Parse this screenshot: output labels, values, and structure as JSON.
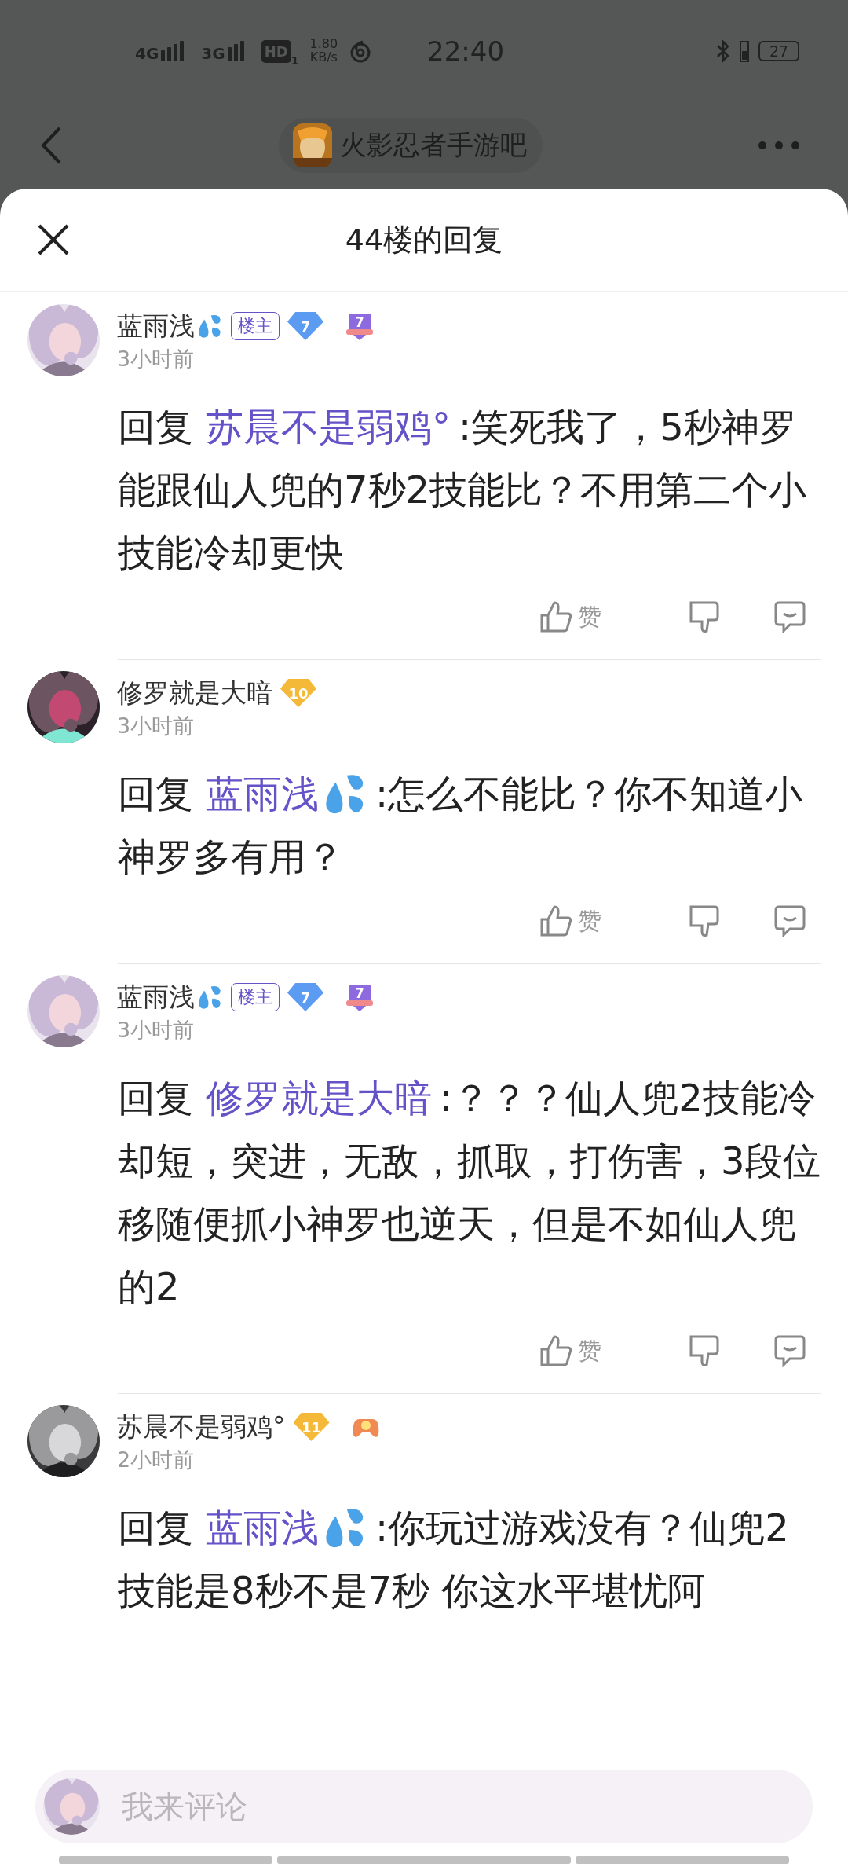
{
  "status_bar": {
    "network_1": "4G",
    "network_2": "3G",
    "hd": "HD",
    "hd_sub": "1",
    "speed_value": "1.80",
    "speed_unit": "KB/s",
    "time": "22:40",
    "battery": "27"
  },
  "nav": {
    "forum_name": "火影忍者手游吧"
  },
  "sheet": {
    "title": "44楼的回复"
  },
  "comments": [
    {
      "user": "蓝雨浅",
      "name_emoji": {
        "kind": "droplets"
      },
      "host_tag": "楼主",
      "level": {
        "label": "7",
        "color": "#5b9cf2"
      },
      "medal": {
        "kind": "shield",
        "label": "7"
      },
      "time": "3小时前",
      "reply_prefix": "回复",
      "reply_to": "苏晨不是弱鸡°",
      "text": ":笑死我了，5秒神罗能跟仙人兜的7秒2技能比？不用第二个小技能冷却更快",
      "like_label": "赞"
    },
    {
      "user": "修罗就是大暗",
      "level": {
        "label": "10",
        "color": "#f5b93a"
      },
      "time": "3小时前",
      "reply_prefix": "回复",
      "reply_to": "蓝雨浅",
      "reply_to_emoji": {
        "kind": "droplets"
      },
      "text": ":怎么不能比？你不知道小神罗多有用？",
      "like_label": "赞"
    },
    {
      "user": "蓝雨浅",
      "name_emoji": {
        "kind": "droplets"
      },
      "host_tag": "楼主",
      "level": {
        "label": "7",
        "color": "#5b9cf2"
      },
      "medal": {
        "kind": "shield",
        "label": "7"
      },
      "time": "3小时前",
      "reply_prefix": "回复",
      "reply_to": "修罗就是大暗",
      "text": ":？？？仙人兜2技能冷却短，突进，无敌，抓取，打伤害，3段位移随便抓小神罗也逆天，但是不如仙人兜的2",
      "like_label": "赞"
    },
    {
      "user": "苏晨不是弱鸡°",
      "level": {
        "label": "11",
        "color": "#f5b93a"
      },
      "medal": {
        "kind": "gamepad"
      },
      "time": "2小时前",
      "reply_prefix": "回复",
      "reply_to": "蓝雨浅",
      "reply_to_emoji": {
        "kind": "droplets"
      },
      "text": ":你玩过游戏没有？仙兜2技能是8秒不是7秒 你这水平堪忧阿"
    }
  ],
  "composer": {
    "placeholder": "我来评论"
  }
}
